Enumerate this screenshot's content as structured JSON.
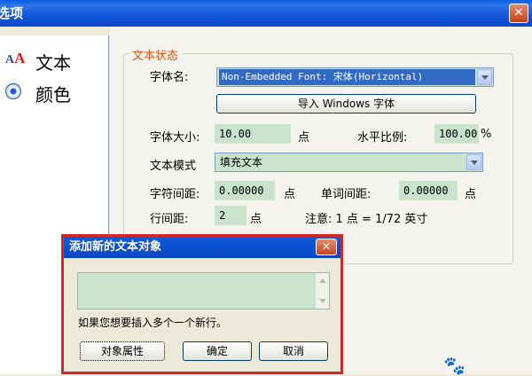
{
  "window": {
    "title": "选项"
  },
  "sidebar": {
    "items": [
      {
        "label": "文本",
        "icon": "text-style-icon"
      },
      {
        "label": "颜色",
        "icon": "radio-selected-icon"
      }
    ]
  },
  "text_state": {
    "group_title": "文本状态",
    "font_name_label": "字体名:",
    "font_name_value": "Non-Embedded Font: 宋体(Horizontal)",
    "import_button": "导入 Windows 字体",
    "font_size_label": "字体大小:",
    "font_size_value": "10.00",
    "font_size_unit": "点",
    "h_scale_label": "水平比例:",
    "h_scale_value": "100.00",
    "h_scale_unit": "%",
    "text_mode_label": "文本模式",
    "text_mode_value": "填充文本",
    "char_spacing_label": "字符间距:",
    "char_spacing_value": "0.00000",
    "char_spacing_unit": "点",
    "word_spacing_label": "单词间距:",
    "word_spacing_value": "0.00000",
    "word_spacing_unit": "点",
    "line_spacing_label": "行间距:",
    "line_spacing_value": "2",
    "line_spacing_unit": "点",
    "note": "注意: 1 点 = 1/72 英寸"
  },
  "dialog": {
    "title": "添加新的文本对象",
    "textarea_value": "",
    "hint": "如果您想要插入多个一个新行。",
    "buttons": {
      "properties": "对象属性",
      "ok": "确定",
      "cancel": "取消"
    },
    "close_glyph": "✕"
  },
  "colors": {
    "titlebar": "#0a5de0",
    "field_bg": "#c9e3cc",
    "group_title": "#e0560e",
    "dialog_highlight": "#d42828"
  }
}
